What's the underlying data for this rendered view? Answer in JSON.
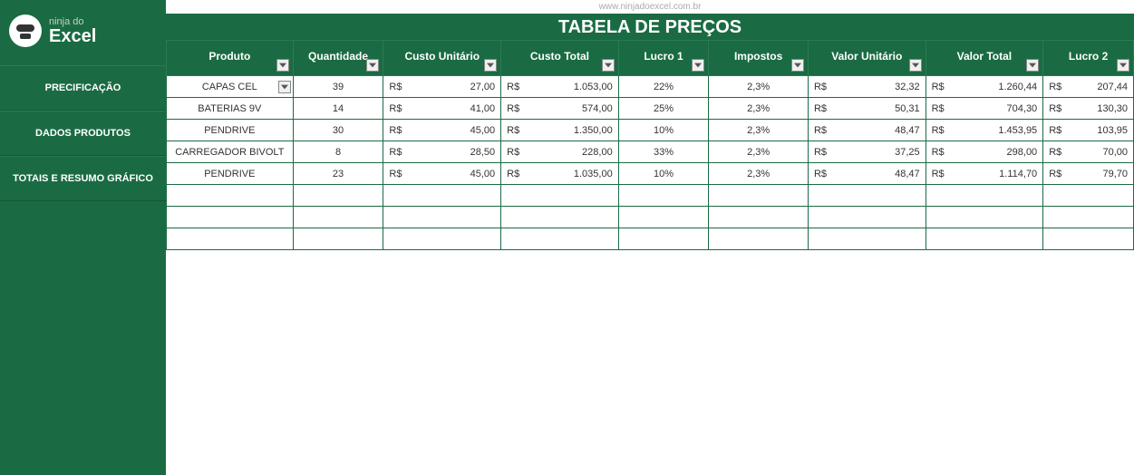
{
  "brand": {
    "top": "ninja do",
    "bottom": "Excel"
  },
  "url": "www.ninjadoexcel.com.br",
  "title": "TABELA DE PREÇOS",
  "sidebar": {
    "items": [
      {
        "label": "PRECIFICAÇÃO"
      },
      {
        "label": "DADOS PRODUTOS"
      },
      {
        "label": "TOTAIS E RESUMO GRÁFICO"
      }
    ]
  },
  "table": {
    "currency": "R$",
    "headers": [
      "Produto",
      "Quantidade",
      "Custo Unitário",
      "Custo Total",
      "Lucro 1",
      "Impostos",
      "Valor Unitário",
      "Valor Total",
      "Lucro 2"
    ],
    "rows": [
      {
        "produto": "CAPAS CEL",
        "qtd": "39",
        "custo_unit": "27,00",
        "custo_total": "1.053,00",
        "lucro1": "22%",
        "impostos": "2,3%",
        "valor_unit": "32,32",
        "valor_total": "1.260,44",
        "lucro2": "207,44"
      },
      {
        "produto": "BATERIAS 9V",
        "qtd": "14",
        "custo_unit": "41,00",
        "custo_total": "574,00",
        "lucro1": "25%",
        "impostos": "2,3%",
        "valor_unit": "50,31",
        "valor_total": "704,30",
        "lucro2": "130,30"
      },
      {
        "produto": "PENDRIVE",
        "qtd": "30",
        "custo_unit": "45,00",
        "custo_total": "1.350,00",
        "lucro1": "10%",
        "impostos": "2,3%",
        "valor_unit": "48,47",
        "valor_total": "1.453,95",
        "lucro2": "103,95"
      },
      {
        "produto": "CARREGADOR BIVOLT",
        "qtd": "8",
        "custo_unit": "28,50",
        "custo_total": "228,00",
        "lucro1": "33%",
        "impostos": "2,3%",
        "valor_unit": "37,25",
        "valor_total": "298,00",
        "lucro2": "70,00"
      },
      {
        "produto": "PENDRIVE",
        "qtd": "23",
        "custo_unit": "45,00",
        "custo_total": "1.035,00",
        "lucro1": "10%",
        "impostos": "2,3%",
        "valor_unit": "48,47",
        "valor_total": "1.114,70",
        "lucro2": "79,70"
      }
    ],
    "empty_rows": 3
  }
}
